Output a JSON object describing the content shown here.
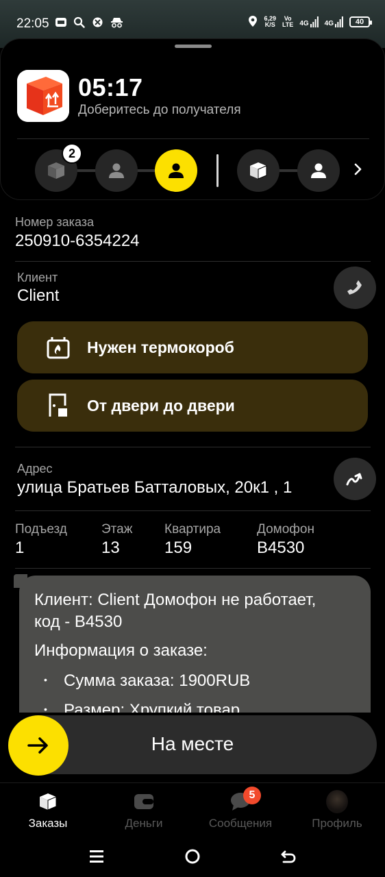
{
  "status_bar": {
    "time": "22:05",
    "speed_value": "6,29",
    "speed_unit": "K/S",
    "volte_top": "Vo",
    "volte_bottom": "LTE",
    "net1": "4G",
    "net2": "4G",
    "battery": "40",
    "icons": [
      "mts-icon",
      "search-icon",
      "bug-icon",
      "incognito-icon",
      "location-icon",
      "signal-icon"
    ]
  },
  "header": {
    "timer": "05:17",
    "subtitle": "Доберитесь до получателя",
    "pickup_count_badge": "2",
    "app_icon": "package-box-icon",
    "accent_color": "#fce000"
  },
  "order": {
    "number_label": "Номер заказа",
    "number_value": "250910-6354224"
  },
  "client": {
    "label": "Клиент",
    "value": "Client"
  },
  "tags": [
    {
      "label": "Нужен термокороб",
      "icon": "thermobox-icon"
    },
    {
      "label": "От двери до двери",
      "icon": "door-icon"
    }
  ],
  "address": {
    "label": "Адрес",
    "value": "улица Братьев Батталовых, 20к1 , 1"
  },
  "details": [
    {
      "label": "Подъезд",
      "value": "1"
    },
    {
      "label": "Этаж",
      "value": "13"
    },
    {
      "label": "Квартира",
      "value": "159"
    },
    {
      "label": "Домофон",
      "value": "В4530"
    }
  ],
  "comment": {
    "line1": "Клиент: Client Домофон не работает,",
    "line2": "код - В4530",
    "info_heading": "Информация о заказе:",
    "bullet1": "Сумма заказа: 1900RUB",
    "bullet2": "Размер: Хрупкий товар"
  },
  "action": {
    "label": "На месте"
  },
  "tabs": [
    {
      "label": "Заказы",
      "icon": "orders-box-icon",
      "active": true
    },
    {
      "label": "Деньги",
      "icon": "wallet-icon",
      "active": false
    },
    {
      "label": "Сообщения",
      "icon": "chat-icon",
      "active": false,
      "badge": "5"
    },
    {
      "label": "Профиль",
      "icon": "avatar-icon",
      "active": false
    }
  ]
}
